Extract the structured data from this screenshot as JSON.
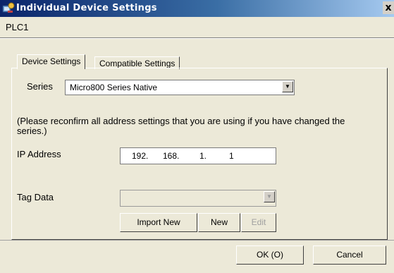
{
  "window": {
    "title": "Individual Device Settings",
    "close_label": "x",
    "device_name": "PLC1"
  },
  "tabs": [
    {
      "label": "Device Settings",
      "active": true
    },
    {
      "label": "Compatible Settings",
      "active": false
    }
  ],
  "form": {
    "series_label": "Series",
    "series_value": "Micro800 Series Native",
    "note": "(Please reconfirm all address settings that you are using if you have changed the series.)",
    "ip_label": "IP Address",
    "ip_octets": [
      "192.",
      "168.",
      "1.",
      "1"
    ],
    "tag_label": "Tag Data",
    "tag_value": ""
  },
  "buttons": {
    "import_new": "Import New",
    "new": "New",
    "edit": "Edit",
    "ok": "OK (O)",
    "cancel": "Cancel"
  },
  "colors": {
    "title_start": "#0a246a",
    "title_end": "#a6caf0",
    "face": "#ece9d8"
  }
}
